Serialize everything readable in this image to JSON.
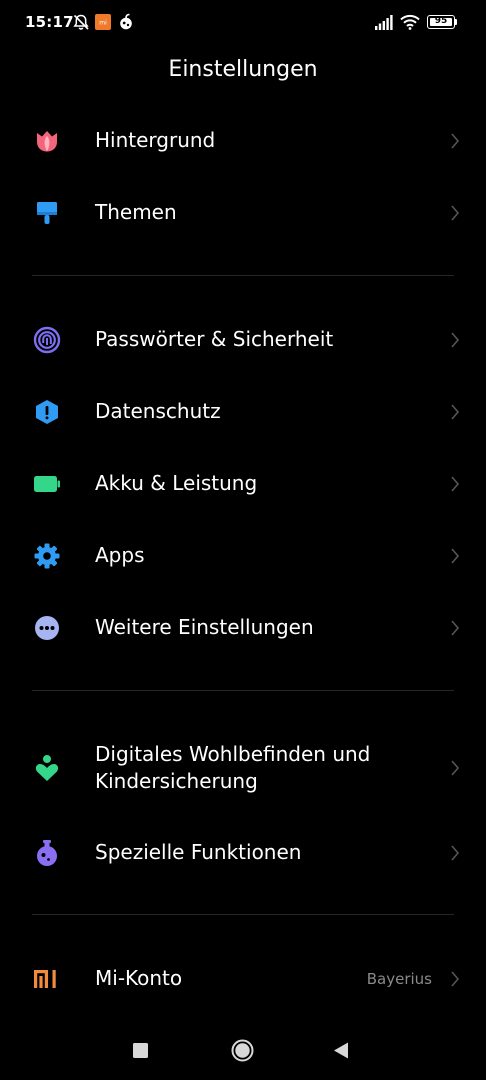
{
  "status_bar": {
    "time": "15:17",
    "battery": "95",
    "icons": [
      "alarm-off-icon",
      "mi-notification-icon",
      "app-notification-icon",
      "signal-icon",
      "wifi-icon",
      "battery-icon"
    ]
  },
  "header": {
    "title": "Einstellungen"
  },
  "groups": [
    {
      "items": [
        {
          "label": "Hintergrund",
          "icon": "tulip-icon",
          "color": "#f2657a"
        },
        {
          "label": "Themen",
          "icon": "brush-icon",
          "color": "#2f9bf2"
        }
      ]
    },
    {
      "items": [
        {
          "label": "Passwörter & Sicherheit",
          "icon": "fingerprint-icon",
          "color": "#7d6ff2"
        },
        {
          "label": "Datenschutz",
          "icon": "shield-icon",
          "color": "#2f9bf2"
        },
        {
          "label": "Akku & Leistung",
          "icon": "battery-icon",
          "color": "#34d68a"
        },
        {
          "label": "Apps",
          "icon": "gear-icon",
          "color": "#2f9bf2"
        },
        {
          "label": "Weitere Einstellungen",
          "icon": "more-icon",
          "color": "#a7b4f2"
        }
      ]
    },
    {
      "items": [
        {
          "label_line1": "Digitales Wohlbefinden und",
          "label_line2": "Kindersicherung",
          "icon": "wellbeing-icon",
          "color": "#34d68a"
        },
        {
          "label": "Spezielle Funktionen",
          "icon": "potion-icon",
          "color": "#8a6ff2"
        }
      ]
    },
    {
      "items": [
        {
          "label": "Mi-Konto",
          "value": "Bayerius",
          "icon": "mi-logo-icon",
          "color": "#f08c3c"
        }
      ]
    }
  ],
  "nav_bar": {
    "buttons": [
      "recents-button",
      "home-button",
      "back-button"
    ]
  }
}
